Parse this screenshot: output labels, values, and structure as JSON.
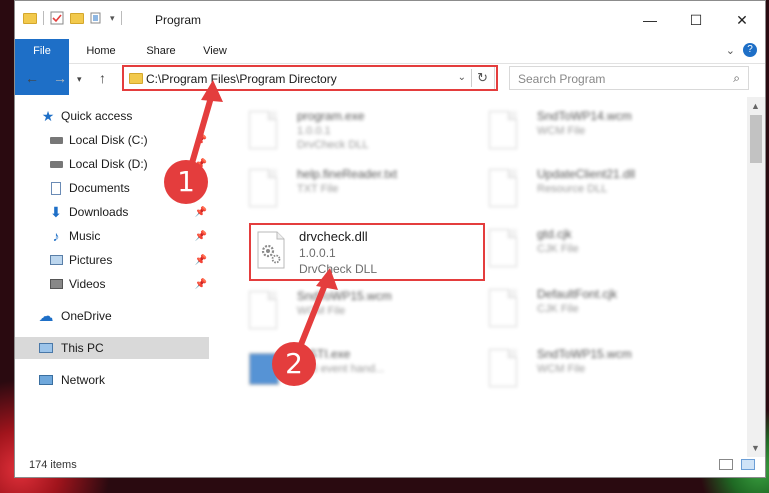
{
  "window": {
    "title": "Program"
  },
  "ribbon": {
    "tabs": [
      "File",
      "Home",
      "Share",
      "View"
    ],
    "help": "?"
  },
  "nav": {
    "address": "C:\\Program Files\\Program Directory",
    "search_placeholder": "Search Program"
  },
  "sidebar": {
    "items": [
      {
        "label": "Quick access",
        "icon": "star-icon"
      },
      {
        "label": "Local Disk (C:)",
        "icon": "drive-icon"
      },
      {
        "label": "Local Disk (D:)",
        "icon": "drive-icon"
      },
      {
        "label": "Documents",
        "icon": "documents-icon"
      },
      {
        "label": "Downloads",
        "icon": "download-arrow-icon"
      },
      {
        "label": "Music",
        "icon": "music-note-icon"
      },
      {
        "label": "Pictures",
        "icon": "pictures-icon"
      },
      {
        "label": "Videos",
        "icon": "film-icon"
      },
      {
        "label": "OneDrive",
        "icon": "cloud-icon"
      },
      {
        "label": "This PC",
        "icon": "monitor-icon"
      },
      {
        "label": "Network",
        "icon": "network-icon"
      }
    ]
  },
  "files": [
    {
      "name": "program.exe",
      "l2": "1.0.0.1",
      "l3": "DrvCheck DLL"
    },
    {
      "name": "SndToWP14.wcm",
      "l2": "WCM File",
      "l3": ""
    },
    {
      "name": "help.fineReader.txt",
      "l2": "TXT File",
      "l3": ""
    },
    {
      "name": "UpdateClient21.dll",
      "l2": "Resource DLL",
      "l3": ""
    },
    {
      "name": "drvcheck.dll",
      "l2": "1.0.0.1",
      "l3": "DrvCheck DLL"
    },
    {
      "name": "gtd.cjk",
      "l2": "CJK File",
      "l3": ""
    },
    {
      "name": "SndToWP15.wcm",
      "l2": "WCM File",
      "l3": ""
    },
    {
      "name": "DefaultFont.cjk",
      "l2": "CJK File",
      "l3": ""
    },
    {
      "name": "yySTI.exe",
      "l2": "T sti event hand...",
      "l3": ""
    },
    {
      "name": "SndToWP15.wcm",
      "l2": "WCM File",
      "l3": ""
    }
  ],
  "status": {
    "count": "174 items"
  },
  "annotations": {
    "step1": "1",
    "step2": "2"
  },
  "colors": {
    "accent": "#1e6fc7",
    "highlight": "#e43d3d"
  }
}
